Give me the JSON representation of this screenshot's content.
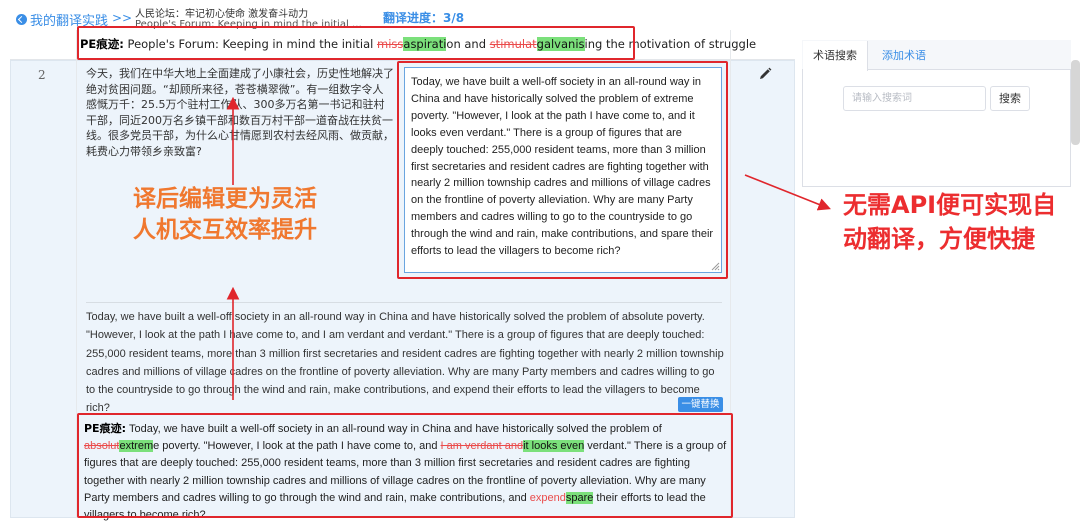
{
  "header": {
    "back_label": "我的翻译实践",
    "separator": ">>",
    "breadcrumb_cn": "人民论坛：牢记初心使命 激发奋斗动力",
    "breadcrumb_en": "People's Forum: Keeping in mind the initial mission and stimulating the motivation of struggle",
    "progress": "翻译进度：3/8"
  },
  "pe_top": {
    "label": "PE痕迹:",
    "parts": [
      {
        "type": "plain",
        "text": " People's Forum: Keeping in mind the initial "
      },
      {
        "type": "del",
        "text": "miss"
      },
      {
        "type": "ins",
        "text": "aspirati"
      },
      {
        "type": "plain",
        "text": "on and "
      },
      {
        "type": "del",
        "text": "stimulat"
      },
      {
        "type": "ins",
        "text": "galvanis"
      },
      {
        "type": "plain",
        "text": "ing the motivation of struggle"
      }
    ]
  },
  "row": {
    "number": "2",
    "source_text": "今天，我们在中华大地上全面建成了小康社会，历史性地解决了绝对贫困问题。“却顾所来径，苍苍横翠微”。有一组数字令人感慨万千：25.5万个驻村工作队、300多万名第一书记和驻村干部，同近200万名乡镇干部和数百万村干部一道奋战在扶贫一线。很多党员干部，为什么心甘情愿到农村去经风雨、做贡献，耗费心力带领乡亲致富?",
    "edit_text": "Today, we have built a well-off society in an all-round way in China and have historically solved the problem of extreme poverty. \"However, I look at the path I have come to, and it looks even verdant.\" There is a group of figures that are deeply touched: 255,000 resident teams, more than 3 million first secretaries and resident cadres are fighting together with nearly 2 million township cadres and millions of village cadres on the frontline of poverty alleviation. Why are many Party members and cadres willing to go to the countryside to go through the wind and rain, make contributions, and spare their efforts to lead the villagers to become rich?",
    "mt_text": "Today, we have built a well-off society in an all-round way in China and have historically solved the problem of absolute poverty. \"However, I look at the path I have come to, and I am verdant and verdant.\" There is a group of figures that are deeply touched: 255,000 resident teams, more than 3 million first secretaries and resident cadres are fighting together with nearly 2 million township cadres and millions of village cadres on the frontline of poverty alleviation. Why are many Party members and cadres willing to go to the countryside to go through the wind and rain, make contributions, and expend their efforts to lead the villagers to become rich?",
    "replace_label": "一键替换"
  },
  "pe_bottom": {
    "label": "PE痕迹:",
    "parts": [
      {
        "type": "plain",
        "text": " Today, we have built a well-off society in an all-round way in China and have historically solved the problem of "
      },
      {
        "type": "del",
        "text": "absolut"
      },
      {
        "type": "ins",
        "text": "extrem"
      },
      {
        "type": "plain",
        "text": "e poverty. \"However, I look at the path I have come to, and "
      },
      {
        "type": "del",
        "text": "I am verdant and"
      },
      {
        "type": "ins",
        "text": "it looks even"
      },
      {
        "type": "plain",
        "text": " verdant.\" There is a group of figures that are deeply touched: 255,000 resident teams, more than 3 million first secretaries and resident cadres are fighting together with nearly 2 million township cadres and millions of village cadres on the frontline of poverty alleviation. Why are many Party members and cadres willing to go through the wind and rain, make contributions, and "
      },
      {
        "type": "delplain",
        "text": "expend"
      },
      {
        "type": "ins",
        "text": "spare"
      },
      {
        "type": "plain",
        "text": " their efforts to lead the villagers to become rich?"
      }
    ]
  },
  "annotations": {
    "left_line1": "译后编辑更为灵活",
    "left_line2": "人机交互效率提升",
    "right_line1": "无需API便可实现自",
    "right_line2": "动翻译，方便快捷"
  },
  "term_panel": {
    "tab_search": "术语搜索",
    "tab_add": "添加术语",
    "search_placeholder": "请输入搜索词",
    "search_value": "",
    "search_button": "搜索"
  },
  "colors": {
    "accent": "#3a8ee6",
    "annotation_red": "#e0262c",
    "insert_green": "#7be07b",
    "delete_red": "#ea4b4b",
    "note_orange": "#f0782f"
  }
}
